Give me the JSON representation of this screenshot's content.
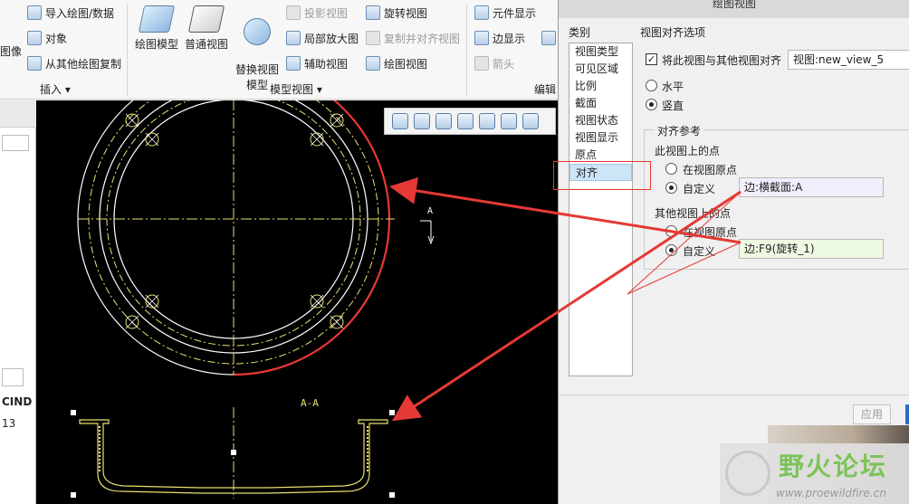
{
  "ribbon": {
    "insert_group": {
      "label": "插入",
      "items": [
        {
          "label": "导入绘图/数据"
        },
        {
          "label": "对象"
        },
        {
          "label": "从其他绘图复制"
        }
      ],
      "partial_left": "图像"
    },
    "model_views_group": {
      "label": "模型视图",
      "big_buttons": [
        {
          "label": "绘图模型"
        },
        {
          "label": "普通视图"
        },
        {
          "label": "替换视图\n模型"
        }
      ],
      "items": [
        {
          "label": "投影视图",
          "disabled": true
        },
        {
          "label": "局部放大图",
          "disabled": false
        },
        {
          "label": "辅助视图",
          "disabled": false
        },
        {
          "label": "旋转视图",
          "disabled": false
        },
        {
          "label": "复制并对齐视图",
          "disabled": true
        },
        {
          "label": "绘图视图",
          "disabled": false
        }
      ]
    },
    "edit_group": {
      "label": "编辑",
      "items": [
        {
          "label": "元件显示",
          "disabled": false
        },
        {
          "label": "边显示",
          "disabled": false
        },
        {
          "label": "箭头",
          "disabled": true
        }
      ]
    }
  },
  "left_strip": {
    "text_a": "CIND",
    "text_b": "13"
  },
  "canvas": {
    "section_label": "A-A",
    "marker_label": "A"
  },
  "dialog": {
    "title": "绘图视图",
    "category_header": "类别",
    "categories": [
      {
        "label": "视图类型",
        "selected": false
      },
      {
        "label": "可见区域",
        "selected": false
      },
      {
        "label": "比例",
        "selected": false
      },
      {
        "label": "截面",
        "selected": false
      },
      {
        "label": "视图状态",
        "selected": false
      },
      {
        "label": "视图显示",
        "selected": false
      },
      {
        "label": "原点",
        "selected": false
      },
      {
        "label": "对齐",
        "selected": true
      }
    ],
    "options_header": "视图对齐选项",
    "align_checkbox": {
      "label": "将此视图与其他视图对齐",
      "checked": true
    },
    "align_view_field": "视图:new_view_5",
    "horizontal_radio": {
      "label": "水平",
      "selected": false
    },
    "vertical_radio": {
      "label": "竖直",
      "selected": true
    },
    "align_ref_header": "对齐参考",
    "this_view_header": "此视图上的点",
    "this_view_origin": {
      "label": "在视图原点",
      "selected": false
    },
    "this_view_custom": {
      "label": "自定义",
      "selected": true
    },
    "this_view_field": "边:横截面:A",
    "other_view_header": "其他视图上的点",
    "other_view_origin": {
      "label": "在视图原点",
      "selected": false
    },
    "other_view_custom": {
      "label": "自定义",
      "selected": true
    },
    "other_view_field": "边:F9(旋转_1)",
    "apply_label": "应用"
  },
  "watermark": {
    "title": "野火论坛",
    "url": "www.proewildfire.cn"
  },
  "colors": {
    "highlight_red": "#e53935",
    "cad_white": "#ffffff",
    "cad_yellow": "#e8e070",
    "selected_blue": "#cce5f7",
    "field_purple": "#f3eefc",
    "field_green": "#eef9e2"
  }
}
